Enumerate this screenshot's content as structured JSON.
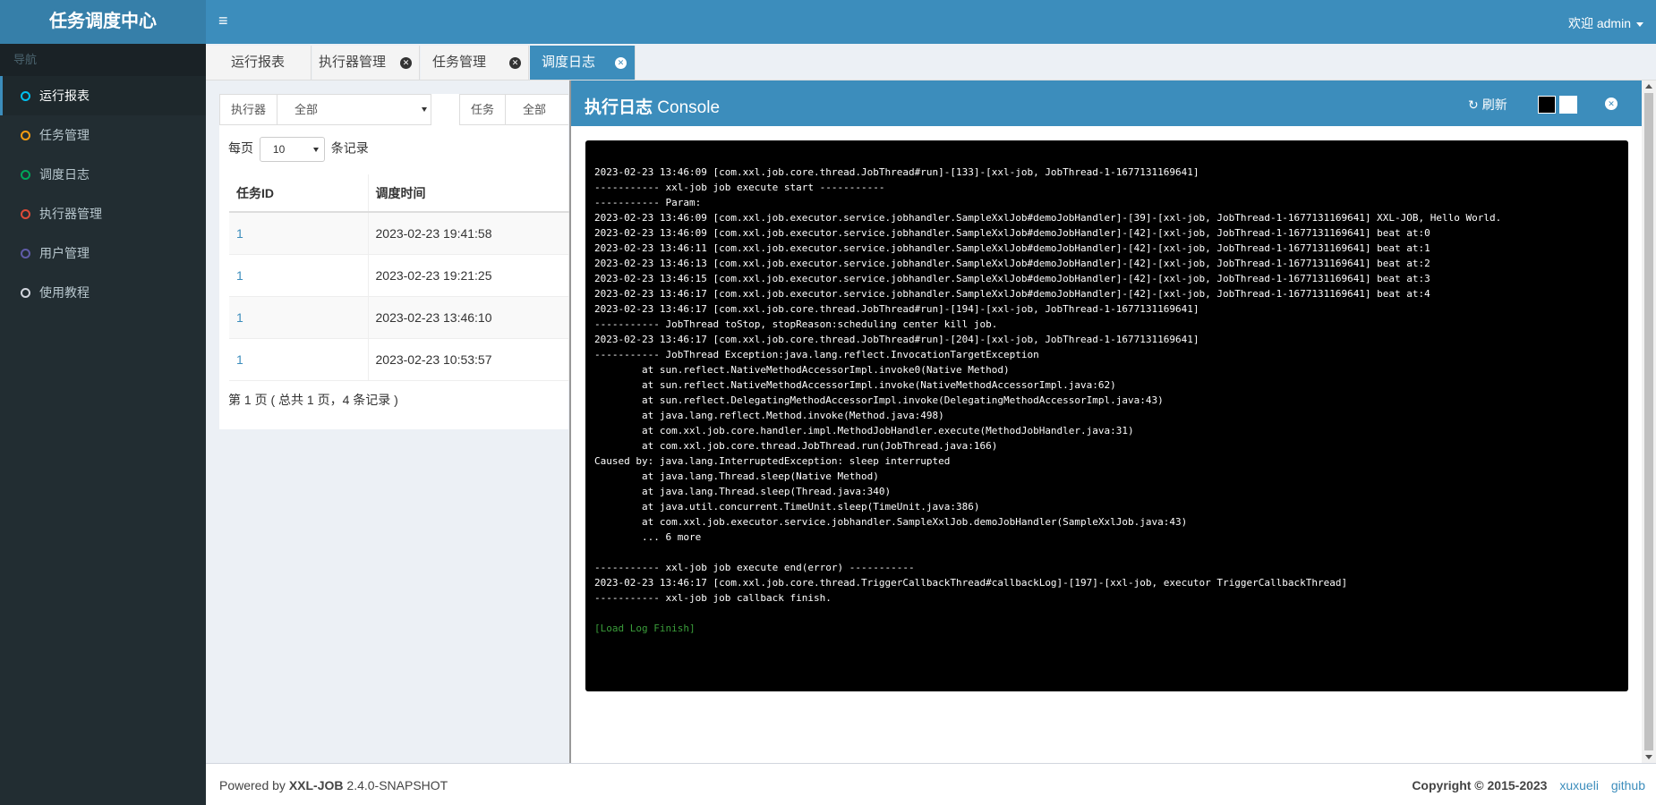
{
  "header": {
    "logo": "任务调度中心",
    "menu_icon": "≡",
    "user": "欢迎 admin"
  },
  "sidebar": {
    "title": "导航",
    "items": [
      {
        "label": "运行报表",
        "color": "#00c0ef"
      },
      {
        "label": "任务管理",
        "color": "#f39c12"
      },
      {
        "label": "调度日志",
        "color": "#00a65a"
      },
      {
        "label": "执行器管理",
        "color": "#dd4b39"
      },
      {
        "label": "用户管理",
        "color": "#605ca8"
      },
      {
        "label": "使用教程",
        "color": "#d2d6de"
      }
    ]
  },
  "tabs": [
    "运行报表",
    "执行器管理",
    "任务管理",
    "调度日志"
  ],
  "filters": {
    "executor_label": "执行器",
    "executor_value": "全部",
    "task_label": "任务",
    "task_value": "全部"
  },
  "pagesize": {
    "prefix": "每页",
    "value": "10",
    "suffix": "条记录"
  },
  "table": {
    "headers": [
      "任务ID",
      "调度时间"
    ],
    "rows": [
      {
        "id": "1",
        "time": "2023-02-23 19:41:58"
      },
      {
        "id": "1",
        "time": "2023-02-23 19:21:25"
      },
      {
        "id": "1",
        "time": "2023-02-23 13:46:10"
      },
      {
        "id": "1",
        "time": "2023-02-23 10:53:57"
      }
    ]
  },
  "page_info": "第 1 页 ( 总共 1 页，4 条记录 )",
  "console": {
    "title_bold": "执行日志",
    "title_rest": " Console",
    "refresh_icon": "↻",
    "refresh": "刷新",
    "log": "2023-02-23 13:46:09 [com.xxl.job.core.thread.JobThread#run]-[133]-[xxl-job, JobThread-1-1677131169641]\n----------- xxl-job job execute start -----------\n----------- Param:\n2023-02-23 13:46:09 [com.xxl.job.executor.service.jobhandler.SampleXxlJob#demoJobHandler]-[39]-[xxl-job, JobThread-1-1677131169641] XXL-JOB, Hello World.\n2023-02-23 13:46:09 [com.xxl.job.executor.service.jobhandler.SampleXxlJob#demoJobHandler]-[42]-[xxl-job, JobThread-1-1677131169641] beat at:0\n2023-02-23 13:46:11 [com.xxl.job.executor.service.jobhandler.SampleXxlJob#demoJobHandler]-[42]-[xxl-job, JobThread-1-1677131169641] beat at:1\n2023-02-23 13:46:13 [com.xxl.job.executor.service.jobhandler.SampleXxlJob#demoJobHandler]-[42]-[xxl-job, JobThread-1-1677131169641] beat at:2\n2023-02-23 13:46:15 [com.xxl.job.executor.service.jobhandler.SampleXxlJob#demoJobHandler]-[42]-[xxl-job, JobThread-1-1677131169641] beat at:3\n2023-02-23 13:46:17 [com.xxl.job.executor.service.jobhandler.SampleXxlJob#demoJobHandler]-[42]-[xxl-job, JobThread-1-1677131169641] beat at:4\n2023-02-23 13:46:17 [com.xxl.job.core.thread.JobThread#run]-[194]-[xxl-job, JobThread-1-1677131169641]\n----------- JobThread toStop, stopReason:scheduling center kill job.\n2023-02-23 13:46:17 [com.xxl.job.core.thread.JobThread#run]-[204]-[xxl-job, JobThread-1-1677131169641]\n----------- JobThread Exception:java.lang.reflect.InvocationTargetException\n        at sun.reflect.NativeMethodAccessorImpl.invoke0(Native Method)\n        at sun.reflect.NativeMethodAccessorImpl.invoke(NativeMethodAccessorImpl.java:62)\n        at sun.reflect.DelegatingMethodAccessorImpl.invoke(DelegatingMethodAccessorImpl.java:43)\n        at java.lang.reflect.Method.invoke(Method.java:498)\n        at com.xxl.job.core.handler.impl.MethodJobHandler.execute(MethodJobHandler.java:31)\n        at com.xxl.job.core.thread.JobThread.run(JobThread.java:166)\nCaused by: java.lang.InterruptedException: sleep interrupted\n        at java.lang.Thread.sleep(Native Method)\n        at java.lang.Thread.sleep(Thread.java:340)\n        at java.util.concurrent.TimeUnit.sleep(TimeUnit.java:386)\n        at com.xxl.job.executor.service.jobhandler.SampleXxlJob.demoJobHandler(SampleXxlJob.java:43)\n        ... 6 more\n\n----------- xxl-job job execute end(error) -----------\n2023-02-23 13:46:17 [com.xxl.job.core.thread.TriggerCallbackThread#callbackLog]-[197]-[xxl-job, executor TriggerCallbackThread]\n----------- xxl-job job callback finish.",
    "finish": "[Load Log Finish]"
  },
  "footer": {
    "powered_prefix": "Powered by ",
    "brand": "XXL-JOB",
    "version": " 2.4.0-SNAPSHOT",
    "copyright": "Copyright © 2015-2023",
    "link1": "xuxueli",
    "link2": "github"
  }
}
